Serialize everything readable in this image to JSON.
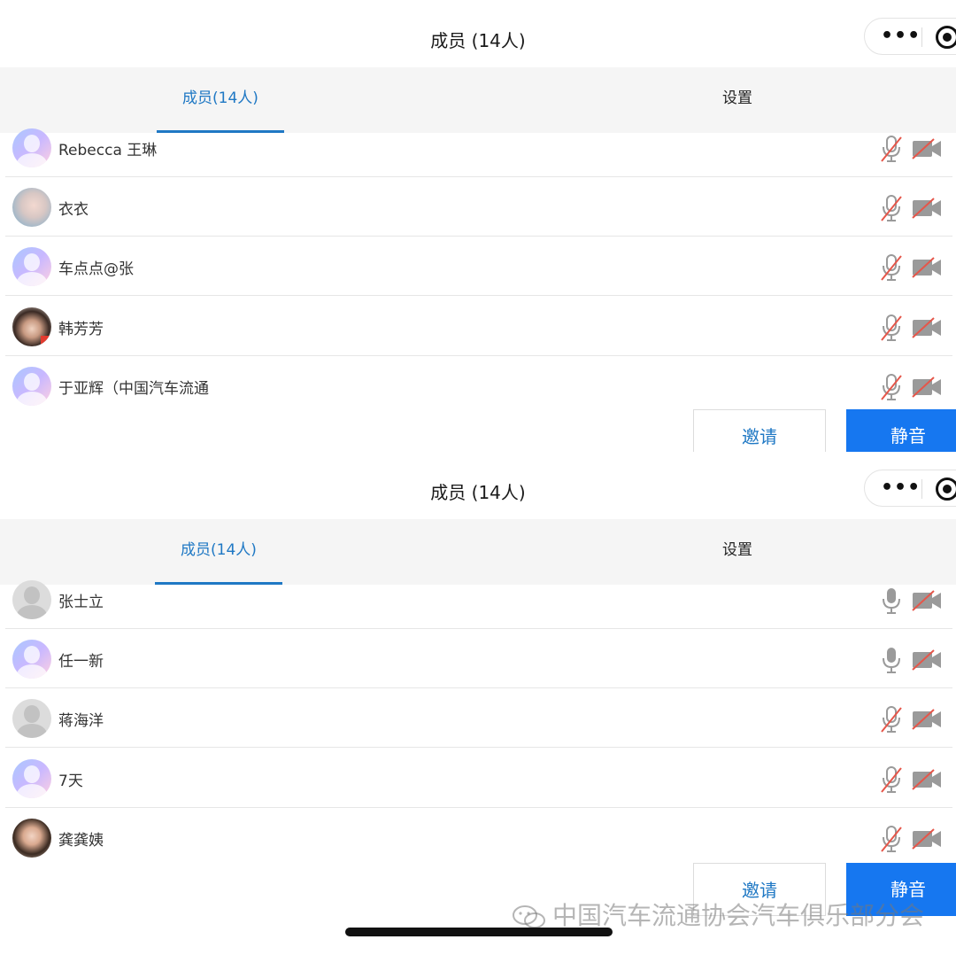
{
  "panels": [
    {
      "title": "成员 (14人)",
      "tabs": {
        "members": "成员(14人)",
        "settings": "设置"
      },
      "members": [
        {
          "name": "Rebecca 王琳",
          "avatar": "default-avatar",
          "mic": "muted",
          "camera": "off"
        },
        {
          "name": "衣衣",
          "avatar": "photo-avatar",
          "mic": "muted",
          "camera": "off"
        },
        {
          "name": "车点点@张",
          "avatar": "default-avatar",
          "mic": "muted",
          "camera": "off"
        },
        {
          "name": "韩芳芳",
          "avatar": "photo-avatar",
          "mic": "muted",
          "camera": "off"
        },
        {
          "name": "于亚辉（中国汽车流通",
          "avatar": "default-avatar",
          "mic": "muted",
          "camera": "off"
        }
      ],
      "buttons": {
        "invite": "邀请",
        "mute": "静音"
      }
    },
    {
      "title": "成员 (14人)",
      "tabs": {
        "members": "成员(14人)",
        "settings": "设置"
      },
      "members": [
        {
          "name": "张士立",
          "avatar": "gray-avatar",
          "mic": "on",
          "camera": "off"
        },
        {
          "name": "任一新",
          "avatar": "default-avatar",
          "mic": "on",
          "camera": "off"
        },
        {
          "name": "蒋海洋",
          "avatar": "gray-avatar",
          "mic": "muted",
          "camera": "off"
        },
        {
          "name": "7天",
          "avatar": "default-avatar",
          "mic": "muted",
          "camera": "off"
        },
        {
          "name": "龚龚姨",
          "avatar": "photo-avatar",
          "mic": "muted",
          "camera": "off"
        }
      ],
      "buttons": {
        "invite": "邀请",
        "mute": "静音"
      }
    }
  ],
  "watermark": "中国汽车流通协会汽车俱乐部分会",
  "icons": {
    "menu": "more-dots-icon",
    "close": "target-icon",
    "mic": "microphone-icon",
    "camera": "video-camera-icon",
    "wechat": "wechat-logo-icon"
  },
  "colors": {
    "accent": "#1f78c4",
    "mute_button": "#1677f0",
    "muted_slash": "#e5564a"
  }
}
